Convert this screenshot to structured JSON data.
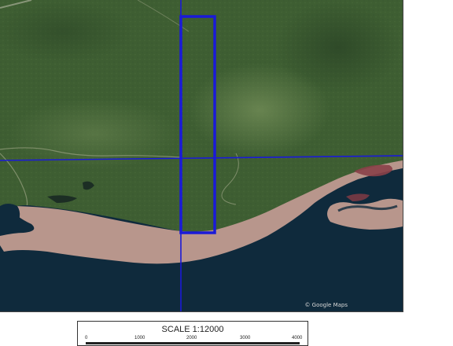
{
  "map": {
    "colors": {
      "forest": "#3e5e32",
      "water": "#0f2a3c",
      "beach": "#b8968c",
      "parcel_line": "#1a1ad8"
    },
    "imagery_credit": "© Google Maps"
  },
  "scale": {
    "title": "SCALE 1:12000",
    "ticks": [
      "0",
      "1000",
      "2000",
      "3000",
      "4000"
    ]
  }
}
